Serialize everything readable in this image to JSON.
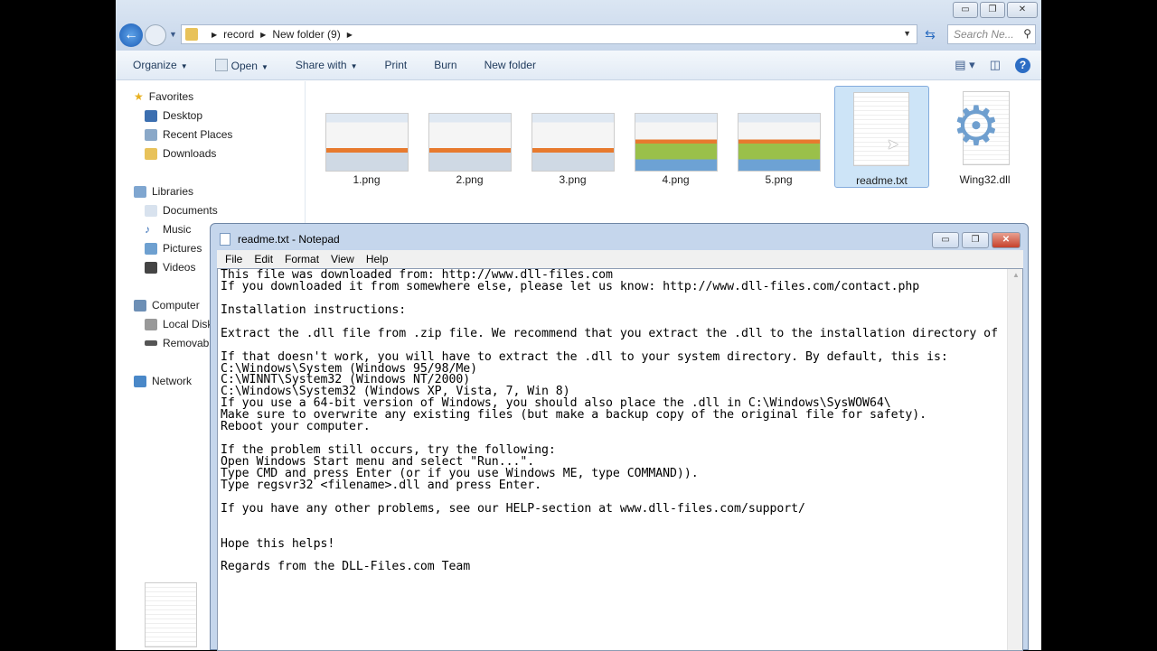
{
  "explorer": {
    "window_buttons": {
      "minimize": "▭",
      "maximize": "❐",
      "close": "✕"
    },
    "breadcrumb": [
      "record",
      "New folder (9)"
    ],
    "search_placeholder": "Search Ne...",
    "toolbar": {
      "organize": "Organize",
      "open": "Open",
      "share_with": "Share with",
      "print": "Print",
      "burn": "Burn",
      "new_folder": "New folder"
    },
    "sidebar": {
      "favorites": "Favorites",
      "desktop": "Desktop",
      "recent_places": "Recent Places",
      "downloads": "Downloads",
      "libraries": "Libraries",
      "documents": "Documents",
      "music": "Music",
      "pictures": "Pictures",
      "videos": "Videos",
      "computer": "Computer",
      "local_disk": "Local Disk",
      "removable": "Removabl",
      "network": "Network"
    },
    "files": [
      {
        "name": "1.png",
        "type": "image"
      },
      {
        "name": "2.png",
        "type": "image"
      },
      {
        "name": "3.png",
        "type": "image"
      },
      {
        "name": "4.png",
        "type": "image"
      },
      {
        "name": "5.png",
        "type": "image"
      },
      {
        "name": "readme.txt",
        "type": "text",
        "selected": true
      },
      {
        "name": "Wing32.dll",
        "type": "dll"
      }
    ]
  },
  "notepad": {
    "title": "readme.txt - Notepad",
    "menu": [
      "File",
      "Edit",
      "Format",
      "View",
      "Help"
    ],
    "lines": [
      "This file was downloaded from: http://www.dll-files.com",
      "If you downloaded it from somewhere else, please let us know: http://www.dll-files.com/contact.php",
      "",
      "Installation instructions:",
      "",
      "Extract the .dll file from .zip file. We recommend that you extract the .dll to the installation directory of",
      "",
      "If that doesn't work, you will have to extract the .dll to your system directory. By default, this is:",
      "C:\\Windows\\System (Windows 95/98/Me)",
      "C:\\WINNT\\System32 (Windows NT/2000)",
      "C:\\Windows\\System32 (Windows XP, Vista, 7, Win 8)",
      "If you use a 64-bit version of Windows, you should also place the .dll in C:\\Windows\\SysWOW64\\",
      "Make sure to overwrite any existing files (but make a backup copy of the original file for safety).",
      "Reboot your computer.",
      "",
      "If the problem still occurs, try the following:",
      "Open Windows Start menu and select \"Run...\".",
      "Type CMD and press Enter (or if you use Windows ME, type COMMAND)).",
      "Type regsvr32 <filename>.dll and press Enter.",
      "",
      "If you have any other problems, see our HELP-section at www.dll-files.com/support/",
      "",
      "",
      "Hope this helps!",
      "",
      "Regards from the DLL-Files.com Team"
    ]
  }
}
